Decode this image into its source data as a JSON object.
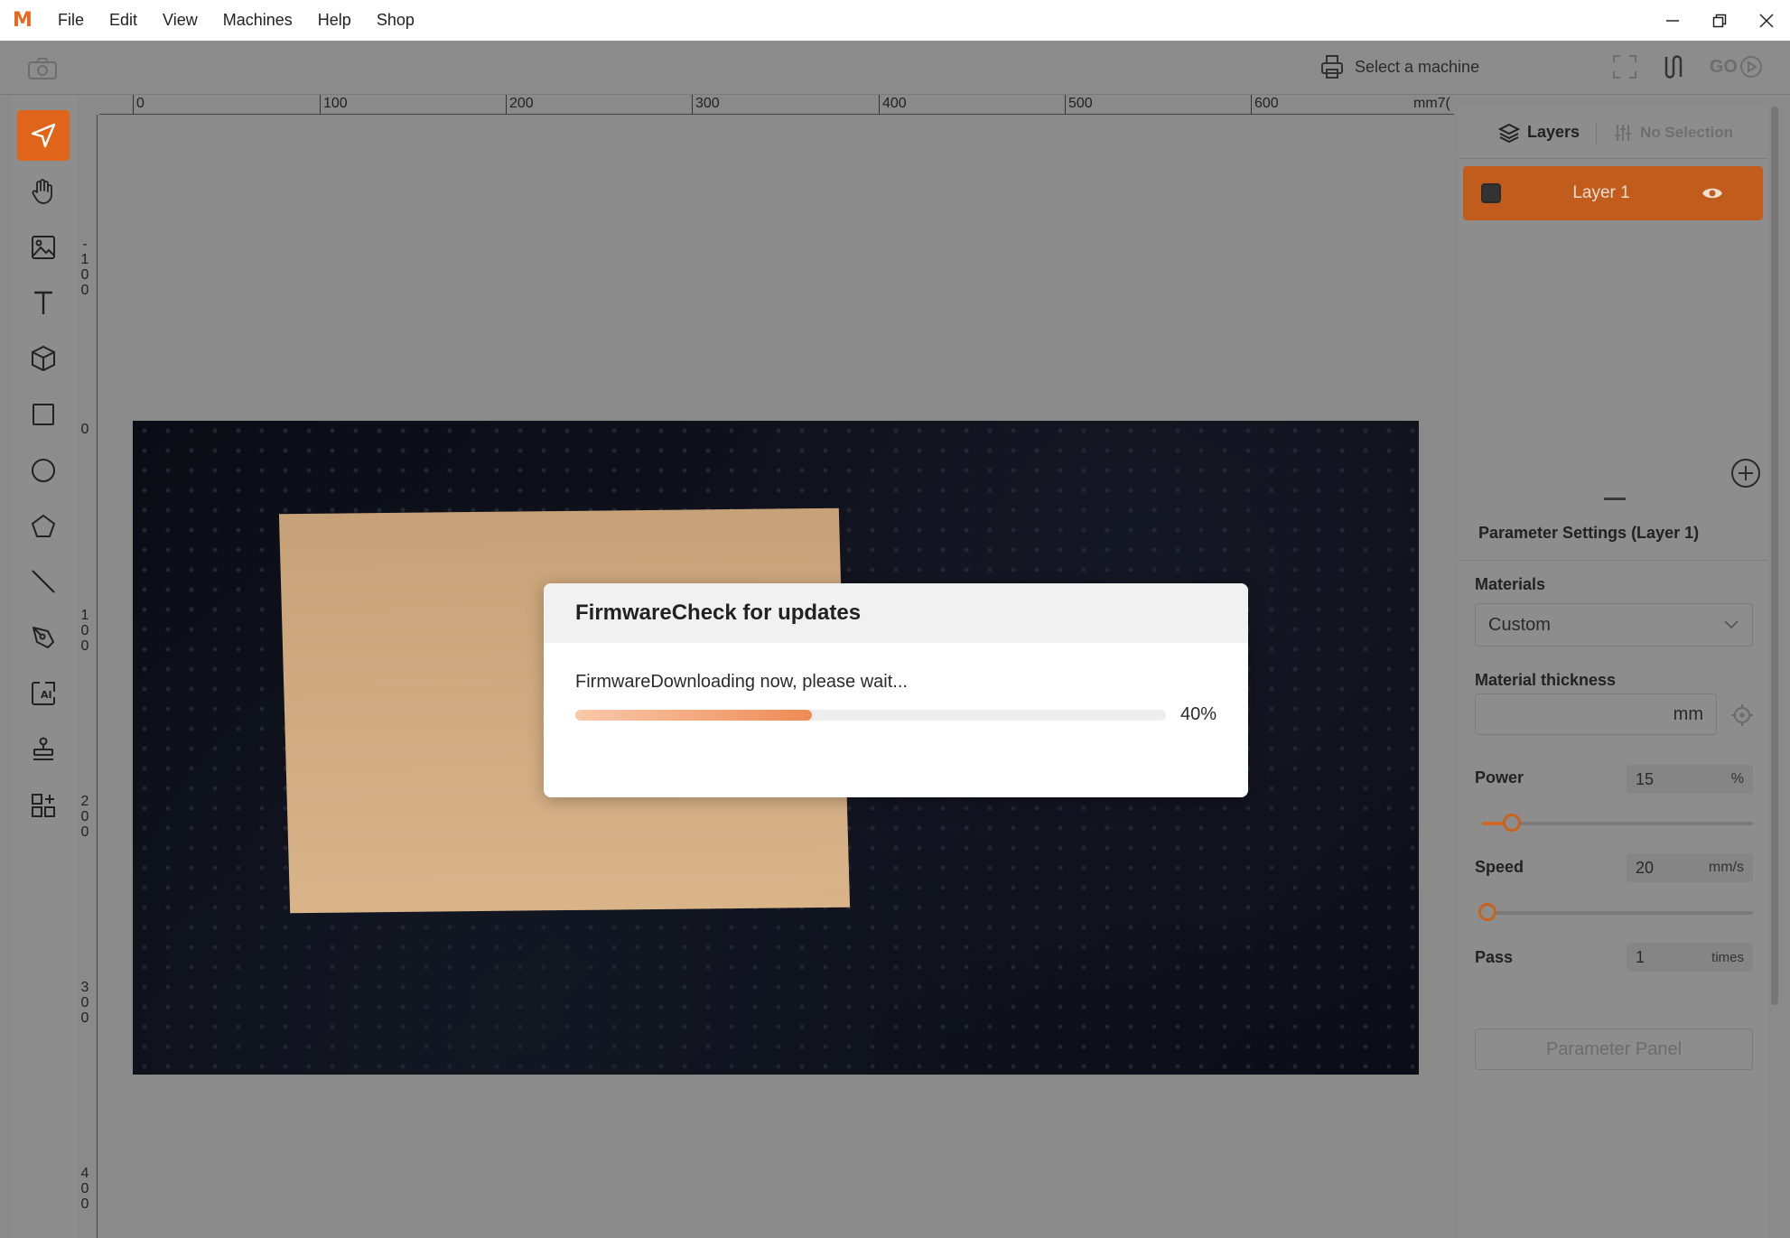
{
  "app": {
    "menu": [
      "File",
      "Edit",
      "View",
      "Machines",
      "Help",
      "Shop"
    ]
  },
  "toolbar": {
    "machine_label": "Select a machine",
    "go_label": "GO"
  },
  "ruler_top": [
    "0",
    "100",
    "200",
    "300",
    "400",
    "500",
    "600",
    "mm7("
  ],
  "ruler_left": [
    "-100",
    "0",
    "100",
    "200",
    "300",
    "400"
  ],
  "right_panel": {
    "tab_layers": "Layers",
    "tab_selection": "No Selection",
    "layer_name": "Layer 1",
    "params_title": "Parameter Settings (Layer 1)",
    "materials_label": "Materials",
    "materials_value": "Custom",
    "thickness_label": "Material thickness",
    "thickness_unit": "mm",
    "power_label": "Power",
    "power_value": "15",
    "power_unit": "%",
    "power_fraction": 0.11,
    "speed_label": "Speed",
    "speed_value": "20",
    "speed_unit": "mm/s",
    "speed_fraction": 0.02,
    "pass_label": "Pass",
    "pass_value": "1",
    "pass_unit": "times",
    "param_panel_button": "Parameter Panel"
  },
  "dialog": {
    "title": "FirmwareCheck for updates",
    "message": "FirmwareDownloading now, please wait...",
    "progress_text": "40%",
    "progress_fraction": 0.4
  },
  "colors": {
    "accent": "#e0651b",
    "layer_bg": "#c25c1c",
    "progress": "#ef8a55"
  }
}
